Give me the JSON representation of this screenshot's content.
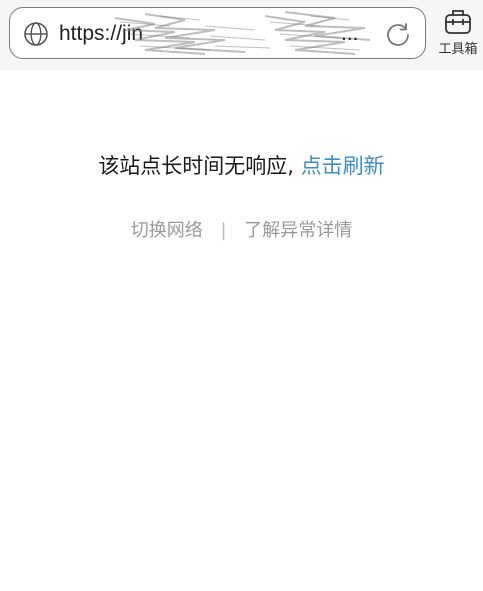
{
  "browser": {
    "url_visible": "https://jin",
    "url_truncation": "...",
    "toolbox_label": "工具箱",
    "icons": {
      "site": "globe-icon",
      "reload": "refresh-icon",
      "toolbox": "toolbox-icon"
    }
  },
  "error_page": {
    "message": "该站点长时间无响应,",
    "refresh_link": "点击刷新",
    "switch_network_link": "切换网络",
    "separator": "|",
    "details_link": "了解异常详情"
  },
  "colors": {
    "link": "#3a8fc9",
    "secondary_text": "#9a9a9a",
    "topbar_bg": "#f6f6f6"
  }
}
